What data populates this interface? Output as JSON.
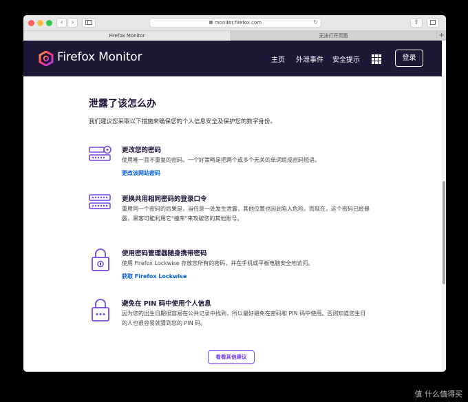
{
  "browser": {
    "url": "monitor.firefox.com",
    "tabs": [
      {
        "label": "Firefox Monitor",
        "active": true
      },
      {
        "label": "无法打开页面",
        "active": false
      }
    ],
    "new_tab_label": "+"
  },
  "header": {
    "brand": "Firefox Monitor",
    "nav": [
      "主页",
      "外泄事件",
      "安全提示"
    ],
    "login_label": "登录"
  },
  "main": {
    "title": "泄露了该怎么办",
    "intro": "我们建议您采取以下措施来确保您的个人信息安全及保护您的数字身份。",
    "tips": [
      {
        "title": "更改您的密码",
        "body": "使用唯一且不重复的密码。一个好策略是把两个或多个无关的单词组成密码短语。",
        "link": "更改该网站密码",
        "icon": "key-icon"
      },
      {
        "title": "更换共用相同密码的登录口令",
        "body": "重用同一个密码的后果是，当任意一处发生泄露，其他位置也因此陷入危险。而现在，这个密码已经暴露，黑客可能利用它\"撞库\"来攻破您的其他账号。",
        "link": "",
        "icon": "password-fields-icon"
      },
      {
        "title": "使用密码管理器随身携带密码",
        "body": "使用 Firefox Lockwise 存放您所有的密码，并在手机或平板电脑安全地访问。",
        "link": "获取 Firefox Lockwise",
        "icon": "lock-icon"
      },
      {
        "title": "避免在 PIN 码中使用个人信息",
        "body": "因为您的出生日期很容易在公共记录中找到，所以最好避免在密码和 PIN 码中使用。否则知道您生日的人也很容易就猜到您的 PIN 码。",
        "link": "",
        "icon": "pin-lock-icon"
      }
    ],
    "more_label": "看看其他建议"
  },
  "watermark": "值 什么值得买",
  "colors": {
    "header_bg": "#1e1836",
    "accent": "#7542e5",
    "link": "#0060df"
  }
}
